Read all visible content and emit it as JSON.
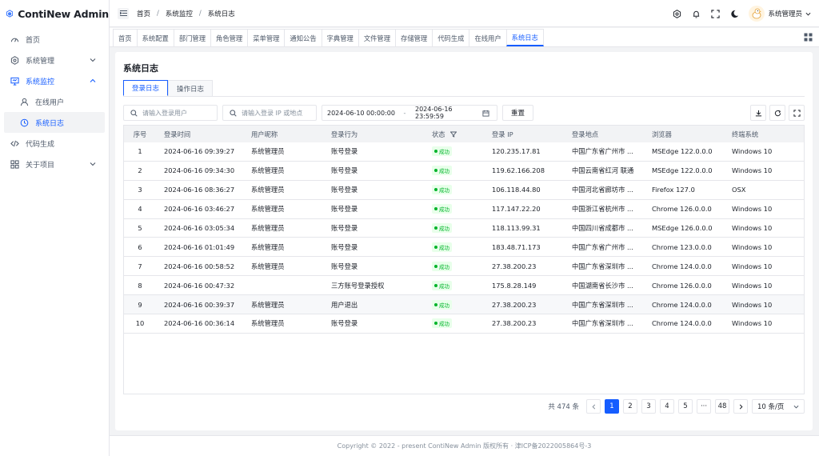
{
  "app": {
    "title": "ContiNew Admin",
    "brand_color": "#165dff"
  },
  "sidebar": {
    "items": [
      {
        "label": "首页",
        "icon": "dashboard-icon"
      },
      {
        "label": "系统管理",
        "icon": "settings-icon",
        "chevron": "down"
      },
      {
        "label": "系统监控",
        "icon": "monitor-icon",
        "chevron": "up",
        "active": true
      },
      {
        "label": "在线用户",
        "icon": "user-icon",
        "sub": true
      },
      {
        "label": "系统日志",
        "icon": "history-icon",
        "sub": true,
        "selected": true
      },
      {
        "label": "代码生成",
        "icon": "code-icon"
      },
      {
        "label": "关于项目",
        "icon": "apps-icon",
        "chevron": "down"
      }
    ]
  },
  "header": {
    "breadcrumb": [
      "首页",
      "系统监控",
      "系统日志"
    ],
    "user_name": "系统管理员"
  },
  "tabs": [
    "首页",
    "系统配置",
    "部门管理",
    "角色管理",
    "菜单管理",
    "通知公告",
    "字典管理",
    "文件管理",
    "存储管理",
    "代码生成",
    "在线用户",
    "系统日志"
  ],
  "active_tab": "系统日志",
  "page": {
    "title": "系统日志",
    "sub_tabs": [
      "登录日志",
      "操作日志"
    ],
    "filters": {
      "user_placeholder": "请输入登录用户",
      "ip_placeholder": "请输入登录 IP 或地点",
      "start": "2024-06-10 00:00:00",
      "range_sep": "-",
      "end": "2024-06-16 23:59:59",
      "reset_label": "重置"
    }
  },
  "table": {
    "columns": [
      "序号",
      "登录时间",
      "用户昵称",
      "登录行为",
      "状态",
      "登录 IP",
      "登录地点",
      "浏览器",
      "终端系统"
    ],
    "status_label": "成功",
    "rows": [
      [
        "1",
        "2024-06-16 09:39:27",
        "系统管理员",
        "账号登录",
        "120.235.17.81",
        "中国广东省广州市 ...",
        "MSEdge 122.0.0.0",
        "Windows 10"
      ],
      [
        "2",
        "2024-06-16 09:34:30",
        "系统管理员",
        "账号登录",
        "119.62.166.208",
        "中国云南省红河 联通",
        "MSEdge 122.0.0.0",
        "Windows 10"
      ],
      [
        "3",
        "2024-06-16 08:36:27",
        "系统管理员",
        "账号登录",
        "106.118.44.80",
        "中国河北省廊坊市 ...",
        "Firefox 127.0",
        "OSX"
      ],
      [
        "4",
        "2024-06-16 03:46:27",
        "系统管理员",
        "账号登录",
        "117.147.22.20",
        "中国浙江省杭州市 ...",
        "Chrome 126.0.0.0",
        "Windows 10"
      ],
      [
        "5",
        "2024-06-16 03:05:34",
        "系统管理员",
        "账号登录",
        "118.113.99.31",
        "中国四川省成都市 ...",
        "MSEdge 126.0.0.0",
        "Windows 10"
      ],
      [
        "6",
        "2024-06-16 01:01:49",
        "系统管理员",
        "账号登录",
        "183.48.71.173",
        "中国广东省广州市 ...",
        "Chrome 123.0.0.0",
        "Windows 10"
      ],
      [
        "7",
        "2024-06-16 00:58:52",
        "系统管理员",
        "账号登录",
        "27.38.200.23",
        "中国广东省深圳市 ...",
        "Chrome 124.0.0.0",
        "Windows 10"
      ],
      [
        "8",
        "2024-06-16 00:47:32",
        "",
        "三方账号登录授权",
        "175.8.28.149",
        "中国湖南省长沙市 ...",
        "Chrome 126.0.0.0",
        "Windows 10"
      ],
      [
        "9",
        "2024-06-16 00:39:37",
        "系统管理员",
        "用户退出",
        "27.38.200.23",
        "中国广东省深圳市 ...",
        "Chrome 124.0.0.0",
        "Windows 10"
      ],
      [
        "10",
        "2024-06-16 00:36:14",
        "系统管理员",
        "账号登录",
        "27.38.200.23",
        "中国广东省深圳市 ...",
        "Chrome 124.0.0.0",
        "Windows 10"
      ]
    ],
    "highlighted_row": 9
  },
  "pagination": {
    "total_text": "共 474 条",
    "pages": [
      "1",
      "2",
      "3",
      "4",
      "5",
      "···",
      "48"
    ],
    "current": "1",
    "page_size": "10 条/页"
  },
  "footer": {
    "text": "Copyright © 2022 - present ContiNew Admin 版权所有 · 津ICP备2022005864号-3"
  }
}
